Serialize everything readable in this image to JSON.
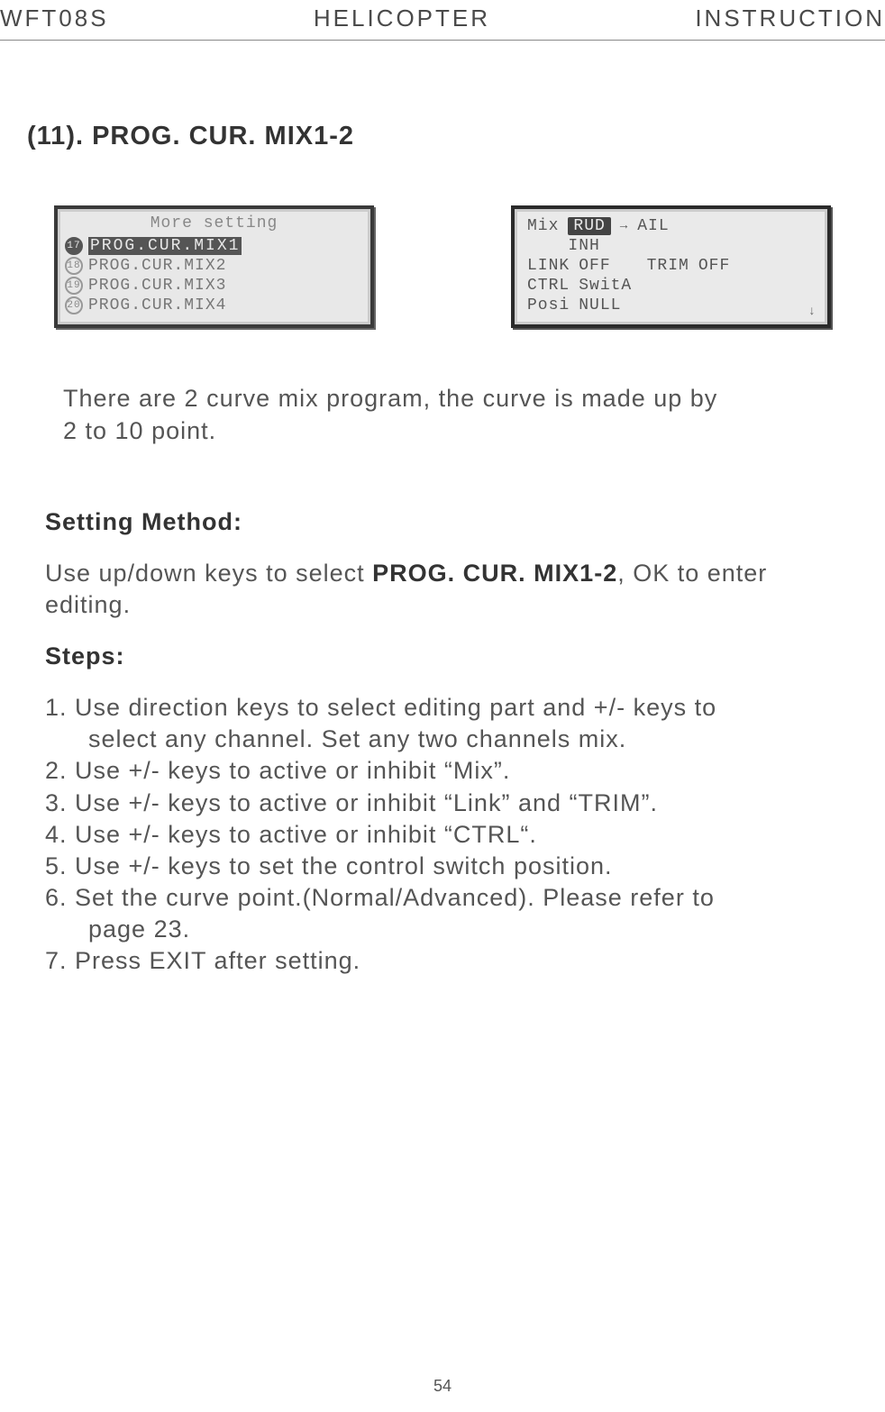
{
  "header": {
    "left": "WFT08S",
    "center": "HELICOPTER",
    "right": "INSTRUCTION"
  },
  "section_title": "(11). PROG. CUR. MIX1-2",
  "lcd_left": {
    "title": "More setting",
    "rows": [
      {
        "num": "17",
        "text": "PROG.CUR.MIX1",
        "selected": true
      },
      {
        "num": "18",
        "text": "PROG.CUR.MIX2",
        "selected": false
      },
      {
        "num": "19",
        "text": "PROG.CUR.MIX3",
        "selected": false
      },
      {
        "num": "20",
        "text": "PROG.CUR.MIX4",
        "selected": false
      }
    ]
  },
  "lcd_right": {
    "r1_label": "Mix",
    "r1_tag": "RUD",
    "r1_arrow": "→",
    "r1_right": "AIL",
    "r2_center": "INH",
    "r3_l1": "LINK",
    "r3_v1": "OFF",
    "r3_l2": "TRIM",
    "r3_v2": "OFF",
    "r4_l": "CTRL",
    "r4_v": "SwitA",
    "r5_l": "Posi",
    "r5_v": "NULL"
  },
  "intro_l1": "There are 2 curve mix program, the curve is made up by",
  "intro_l2": "2 to 10 point.",
  "setting_label": "Setting Method:",
  "setting_p1a": "Use up/down keys to select ",
  "setting_p1b": "PROG. CUR. MIX1-2",
  "setting_p1c": ", OK to enter",
  "setting_p2": "editing.",
  "steps_label": "Steps:",
  "steps": {
    "s1a": "1. Use direction keys to select editing part and +/- keys to",
    "s1b": "select any channel. Set any two channels mix.",
    "s2": "2. Use +/- keys to active or inhibit “Mix”.",
    "s3": "3. Use +/- keys to active or inhibit “Link” and “TRIM”.",
    "s4": "4. Use +/- keys to active or inhibit  “CTRL“.",
    "s5": "5. Use +/- keys to set the control switch position.",
    "s6a": "6. Set the curve point.(Normal/Advanced). Please refer to",
    "s6b": "page 23.",
    "s7": "7. Press EXIT after setting."
  },
  "page_number": "54"
}
